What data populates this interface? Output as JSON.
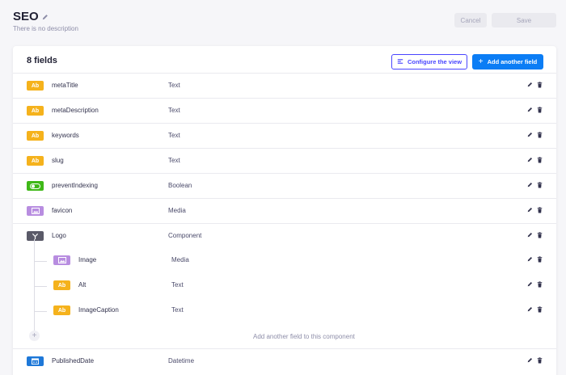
{
  "header": {
    "title": "SEO",
    "subtitle": "There is no description",
    "cancel_label": "Cancel",
    "save_label": "Save"
  },
  "card": {
    "fields_count": "8 fields",
    "configure_label": "Configure the view",
    "add_field_label": "Add another field",
    "add_component_field_label": "Add another field to this component"
  },
  "fields": [
    {
      "badge": "Ab",
      "name": "metaTitle",
      "type": "Text",
      "kind": "text"
    },
    {
      "badge": "Ab",
      "name": "metaDescription",
      "type": "Text",
      "kind": "text"
    },
    {
      "badge": "Ab",
      "name": "keywords",
      "type": "Text",
      "kind": "text"
    },
    {
      "badge": "Ab",
      "name": "slug",
      "type": "Text",
      "kind": "text"
    },
    {
      "badge": "",
      "name": "preventIndexing",
      "type": "Boolean",
      "kind": "boolean"
    },
    {
      "badge": "",
      "name": "favicon",
      "type": "Media",
      "kind": "media"
    },
    {
      "badge": "",
      "name": "Logo",
      "type": "Component",
      "kind": "component"
    },
    {
      "badge": "",
      "name": "Image",
      "type": "Media",
      "kind": "media"
    },
    {
      "badge": "Ab",
      "name": "Alt",
      "type": "Text",
      "kind": "text"
    },
    {
      "badge": "Ab",
      "name": "ImageCaption",
      "type": "Text",
      "kind": "text"
    },
    {
      "badge": "",
      "name": "PublishedDate",
      "type": "Datetime",
      "kind": "datetime"
    }
  ],
  "icons": {
    "title_edit": "pencil-icon",
    "configure": "layout-icon",
    "add": "plus-icon",
    "row_edit": "pencil-icon",
    "row_delete": "trash-icon",
    "boolean": "toggle-icon",
    "media": "image-icon",
    "component": "component-icon",
    "datetime": "calendar-icon"
  },
  "colors": {
    "text_badge": "#f5b21c",
    "boolean_badge": "#3fb818",
    "media_badge": "#b88de0",
    "component_badge": "#5a5a68",
    "datetime_badge": "#1e78d8",
    "primary": "#0b7df5",
    "accent": "#4945ff"
  }
}
